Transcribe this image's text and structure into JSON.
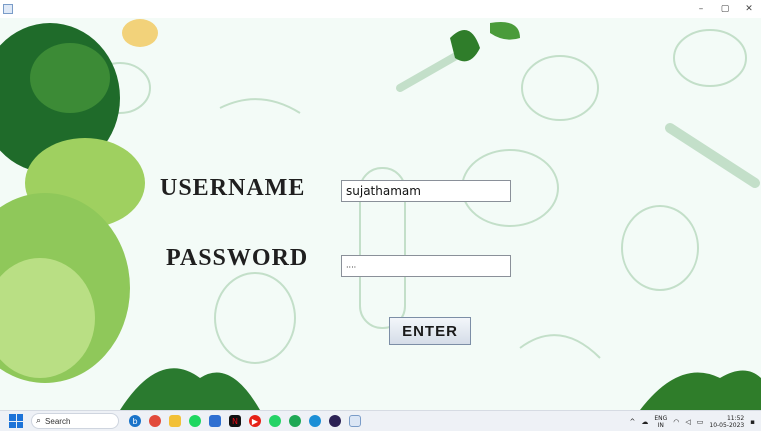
{
  "window": {
    "minimize_glyph": "–",
    "maximize_glyph": "▢",
    "close_glyph": "✕"
  },
  "form": {
    "username_label": "USERNAME",
    "password_label": "PASSWORD",
    "username_value": "sujathamam",
    "password_value": "····",
    "enter_label": "ENTER"
  },
  "taskbar": {
    "search_placeholder": "Search",
    "lang_line1": "ENG",
    "lang_line2": "IN",
    "time": "11:52",
    "date": "10-05-2023",
    "apps": [
      "bing-icon",
      "chrome-icon",
      "file-explorer-icon",
      "spotify-icon",
      "store-icon",
      "netflix-icon",
      "youtube-icon",
      "whatsapp-icon",
      "whatsapp-beta-icon",
      "edge-icon",
      "eclipse-icon",
      "java-app-icon"
    ]
  },
  "colors": {
    "canvas_bg": "#f3fbf7",
    "sketch": "#bfdcc6",
    "leaf_dark": "#2f7d2a",
    "leaf_light": "#8cc84b"
  }
}
